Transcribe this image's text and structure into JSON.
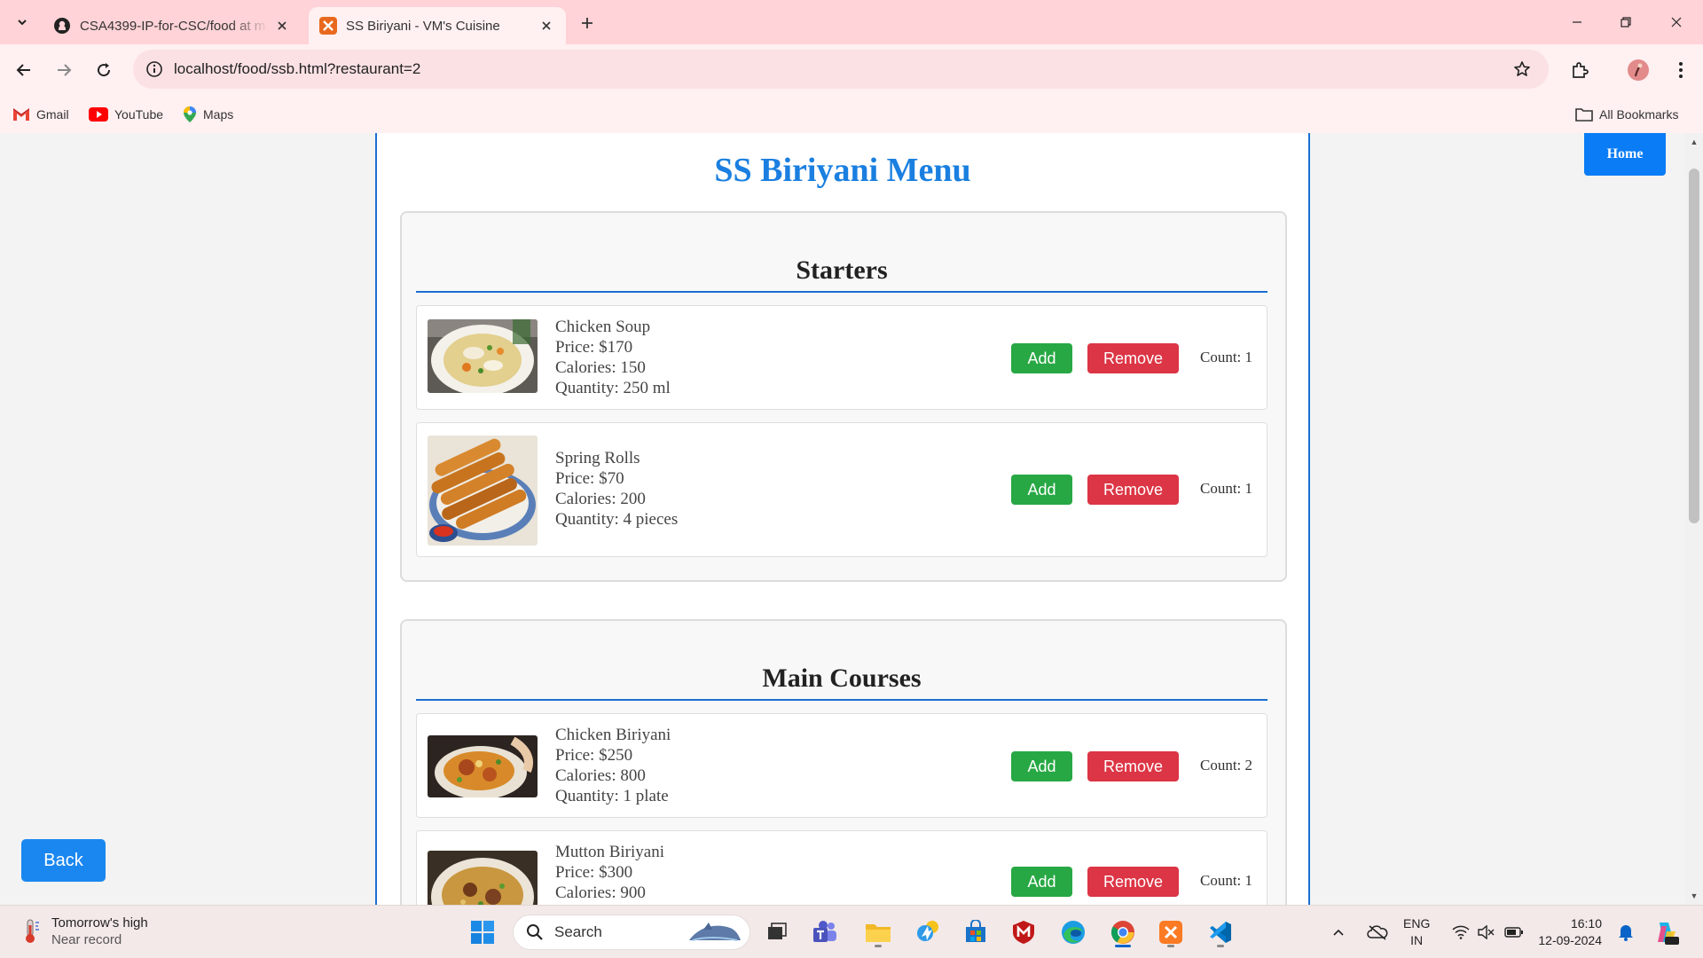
{
  "browser": {
    "tabs": [
      {
        "title": "CSA4399-IP-for-CSC/food at m",
        "active": false
      },
      {
        "title": "SS Biriyani - VM's Cuisine",
        "active": true
      }
    ],
    "url": "localhost/food/ssb.html?restaurant=2",
    "bookmarks": [
      "Gmail",
      "YouTube",
      "Maps"
    ],
    "all_bookmarks_label": "All Bookmarks"
  },
  "page": {
    "home_label": "Home",
    "back_label": "Back",
    "title": "SS Biriyani Menu",
    "sections": [
      {
        "title": "Starters",
        "items": [
          {
            "name": "Chicken Soup",
            "price": "Price: $170",
            "calories": "Calories: 150",
            "quantity": "Quantity: 250 ml",
            "add_label": "Add",
            "remove_label": "Remove",
            "count": "Count: 1"
          },
          {
            "name": "Spring Rolls",
            "price": "Price: $70",
            "calories": "Calories: 200",
            "quantity": "Quantity: 4 pieces",
            "add_label": "Add",
            "remove_label": "Remove",
            "count": "Count: 1"
          }
        ]
      },
      {
        "title": "Main Courses",
        "items": [
          {
            "name": "Chicken Biriyani",
            "price": "Price: $250",
            "calories": "Calories: 800",
            "quantity": "Quantity: 1 plate",
            "add_label": "Add",
            "remove_label": "Remove",
            "count": "Count: 2"
          },
          {
            "name": "Mutton Biriyani",
            "price": "Price: $300",
            "calories": "Calories: 900",
            "add_label": "Add",
            "remove_label": "Remove",
            "count": "Count: 1"
          }
        ]
      }
    ]
  },
  "taskbar": {
    "weather_title": "Tomorrow's high",
    "weather_sub": "Near record",
    "search_placeholder": "Search",
    "lang_top": "ENG",
    "lang_bottom": "IN",
    "time": "16:10",
    "date": "12-09-2024"
  },
  "colors": {
    "accent": "#1a7fe0",
    "add": "#27a844",
    "remove": "#dc3545",
    "tabbar": "#ffd3d7"
  }
}
